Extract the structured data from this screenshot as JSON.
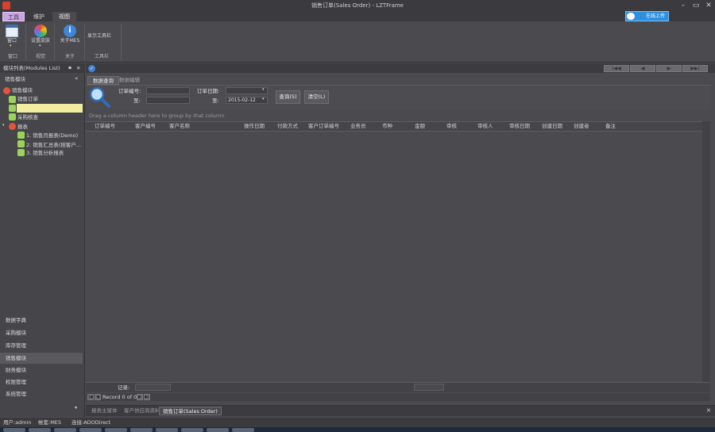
{
  "window": {
    "title": "销售订单(Sales Order) - LZTFrame",
    "minimize": "–",
    "restore": "▭",
    "close": "✕"
  },
  "ribbon_tabs": {
    "file": "工具",
    "maintain": "维护",
    "view": "视图"
  },
  "online_button": "在线上传",
  "ribbon": {
    "window_btn": "窗口",
    "skin_btn": "设置皮肤",
    "about_btn": "关于MES",
    "show_toolbar_btn": "显示工具栏",
    "group_window": "窗口",
    "group_skin": "视觉",
    "group_about": "关于",
    "group_toolbar": "工具栏"
  },
  "left_panel": {
    "header": "模块列表(Modules List)",
    "pin": "▪",
    "close": "✕",
    "section_title": "销售模块",
    "collapse": "«",
    "tree": {
      "root1": "销售模块",
      "sales_order": "销售订单",
      "selected_item": "",
      "purchase_check": "采购核查",
      "root2": "报表",
      "report1": "1. 销售月报表(Demo)",
      "report2": "2. 销售汇总表(按客户...",
      "report3": "3. 销售分析报表"
    },
    "bottom_nav": {
      "data_dict": "数据字典",
      "purchase": "采购模块",
      "inventory": "库存管理",
      "sales": "销售模块",
      "finance": "财务模块",
      "permission": "权限管理",
      "system": "系统管理"
    },
    "more": "▾"
  },
  "pager": {
    "first": "|◀◀",
    "prev": "◀",
    "next": "▶",
    "last": "▶▶|"
  },
  "inner_tabs": {
    "query": "数据查询",
    "edit": "数据编辑"
  },
  "filter": {
    "order_no_label": "订单编号:",
    "order_no_value": "",
    "to_label": "至:",
    "to_value": "",
    "order_date_label": "订单日期:",
    "date_from_value": "",
    "date_to_label": "至:",
    "date_to_value": "2015-02-12",
    "query_btn": "查询(S)",
    "clear_btn": "清空(L)"
  },
  "grid": {
    "group_hint": "Drag a column header here to group by that column",
    "columns": [
      "订单编号",
      "客户编号",
      "客户名称",
      "操作日期",
      "付款方式",
      "客户订单编号",
      "业务员",
      "币种",
      "金额",
      "审核",
      "审核人",
      "审核日期",
      "创建日期",
      "创建者",
      "备注"
    ],
    "footer_label": "记录:",
    "record_text": "Record 0 of 0"
  },
  "doc_tabs": {
    "tab1": "报表主窗体",
    "tab2": "客户供应商资料",
    "tab3": "销售订单(Sales Order)",
    "close": "✕"
  },
  "status": {
    "user": "用户:admin",
    "account": "帐套:MES",
    "connection": "连接:ADODirect"
  }
}
